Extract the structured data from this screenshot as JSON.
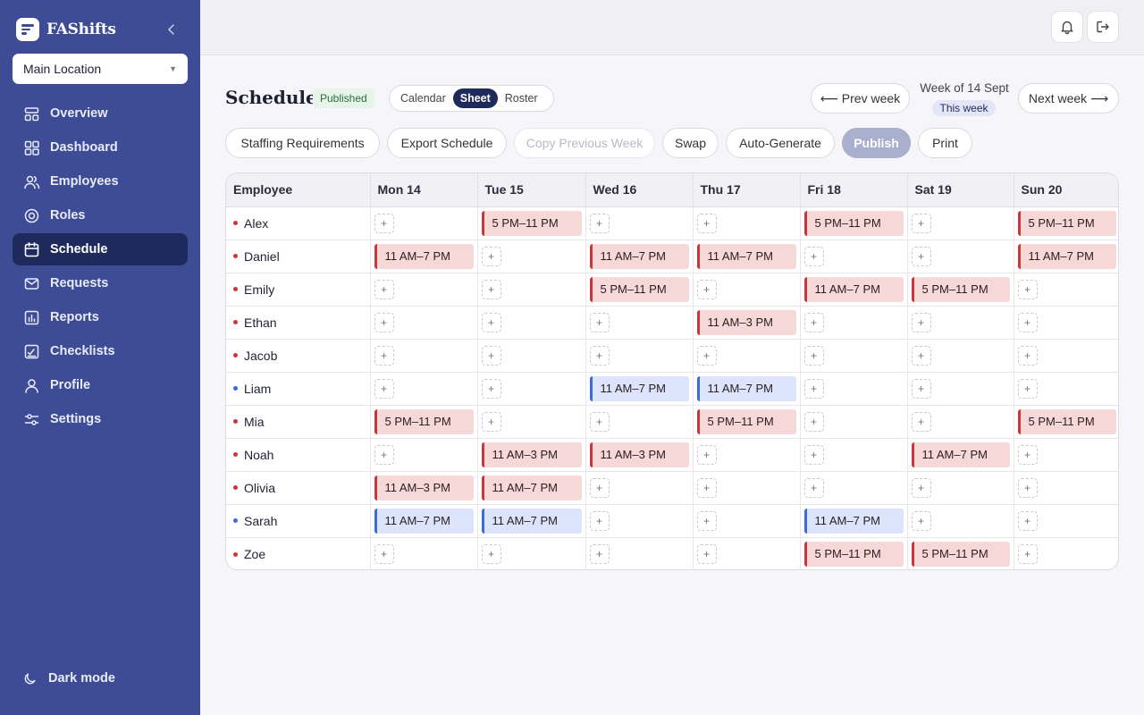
{
  "app": {
    "name": "FAShifts"
  },
  "sidebar": {
    "location": "Main Location",
    "items": [
      {
        "label": "Overview",
        "icon": "overview-icon",
        "active": false
      },
      {
        "label": "Dashboard",
        "icon": "dashboard-icon",
        "active": false
      },
      {
        "label": "Employees",
        "icon": "employees-icon",
        "active": false
      },
      {
        "label": "Roles",
        "icon": "roles-icon",
        "active": false
      },
      {
        "label": "Schedule",
        "icon": "calendar-icon",
        "active": true
      },
      {
        "label": "Requests",
        "icon": "mail-icon",
        "active": false
      },
      {
        "label": "Reports",
        "icon": "reports-icon",
        "active": false
      },
      {
        "label": "Checklists",
        "icon": "checklist-icon",
        "active": false
      },
      {
        "label": "Profile",
        "icon": "profile-icon",
        "active": false
      },
      {
        "label": "Settings",
        "icon": "sliders-icon",
        "active": false
      }
    ],
    "dark_mode_label": "Dark mode"
  },
  "header": {
    "title": "Schedule",
    "status_badge": "Published",
    "views": [
      "Calendar",
      "Sheet",
      "Roster"
    ],
    "active_view": "Sheet",
    "prev_week": "⟵ Prev week",
    "week_label": "Week of 14 Sept",
    "this_week": "This week",
    "next_week": "Next week ⟶"
  },
  "toolbar": {
    "staffing": "Staffing Requirements",
    "export": "Export Schedule",
    "copy_previous": "Copy Previous Week",
    "swap": "Swap",
    "auto_generate": "Auto-Generate",
    "publish": "Publish",
    "print": "Print"
  },
  "colors": {
    "sidebar": "#3e4b95",
    "active_nav": "#1f2a5c",
    "shift_red": "#f7d8d8",
    "shift_red_border": "#c8373a",
    "shift_blue": "#dbe4fa",
    "shift_blue_border": "#3a6cd6"
  },
  "table": {
    "employee_header": "Employee",
    "days": [
      "Mon 14",
      "Tue 15",
      "Wed 16",
      "Thu 17",
      "Fri 18",
      "Sat 19",
      "Sun 20"
    ],
    "add_symbol": "+",
    "rows": [
      {
        "name": "Alex",
        "color": "red",
        "shifts": [
          null,
          "5 PM–11 PM",
          null,
          null,
          "5 PM–11 PM",
          null,
          "5 PM–11 PM"
        ]
      },
      {
        "name": "Daniel",
        "color": "red",
        "shifts": [
          "11 AM–7 PM",
          null,
          "11 AM–7 PM",
          "11 AM–7 PM",
          null,
          null,
          "11 AM–7 PM"
        ]
      },
      {
        "name": "Emily",
        "color": "red",
        "shifts": [
          null,
          null,
          "5 PM–11 PM",
          null,
          "11 AM–7 PM",
          "5 PM–11 PM",
          null
        ]
      },
      {
        "name": "Ethan",
        "color": "red",
        "shifts": [
          null,
          null,
          null,
          "11 AM–3 PM",
          null,
          null,
          null
        ]
      },
      {
        "name": "Jacob",
        "color": "red",
        "shifts": [
          null,
          null,
          null,
          null,
          null,
          null,
          null
        ]
      },
      {
        "name": "Liam",
        "color": "blue",
        "shifts": [
          null,
          null,
          "11 AM–7 PM",
          "11 AM–7 PM",
          null,
          null,
          null
        ]
      },
      {
        "name": "Mia",
        "color": "red",
        "shifts": [
          "5 PM–11 PM",
          null,
          null,
          "5 PM–11 PM",
          null,
          null,
          "5 PM–11 PM"
        ]
      },
      {
        "name": "Noah",
        "color": "red",
        "shifts": [
          null,
          "11 AM–3 PM",
          "11 AM–3 PM",
          null,
          null,
          "11 AM–7 PM",
          null
        ]
      },
      {
        "name": "Olivia",
        "color": "red",
        "shifts": [
          "11 AM–3 PM",
          "11 AM–7 PM",
          null,
          null,
          null,
          null,
          null
        ]
      },
      {
        "name": "Sarah",
        "color": "blue",
        "shifts": [
          "11 AM–7 PM",
          "11 AM–7 PM",
          null,
          null,
          "11 AM–7 PM",
          null,
          null
        ]
      },
      {
        "name": "Zoe",
        "color": "red",
        "shifts": [
          null,
          null,
          null,
          null,
          "5 PM–11 PM",
          "5 PM–11 PM",
          null
        ]
      }
    ]
  }
}
